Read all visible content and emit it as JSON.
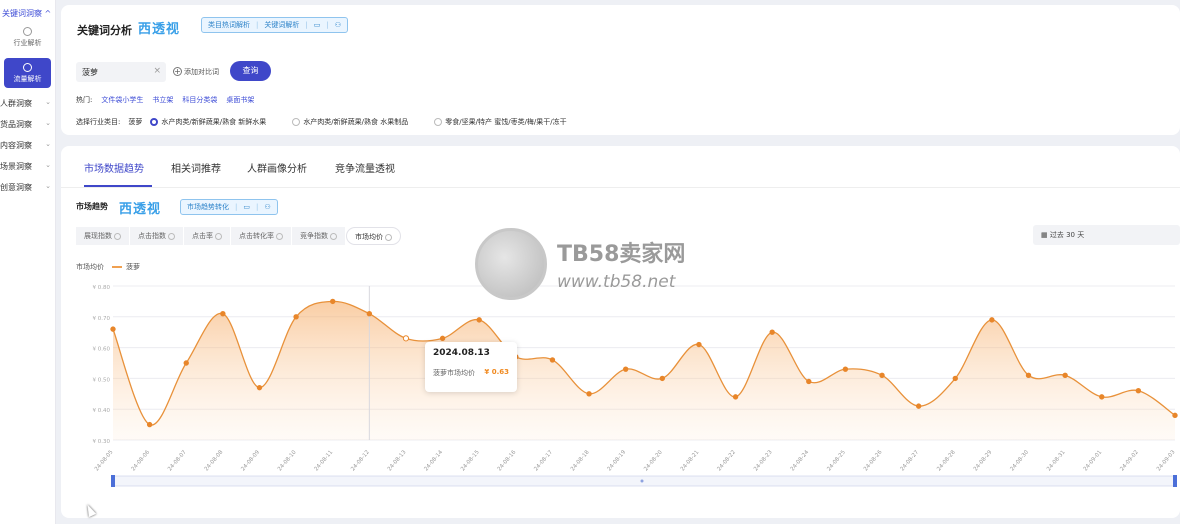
{
  "sidebar": {
    "top_label": "关键词洞察",
    "industry": "行业解析",
    "traffic": "流量解析",
    "items": [
      "人群洞察",
      "货品洞察",
      "内容洞察",
      "场景洞察",
      "创意洞察"
    ]
  },
  "header": {
    "title": "关键词分析",
    "logo": "西透视",
    "chips": [
      "类目热词解析",
      "关键词解析"
    ]
  },
  "search": {
    "value": "菠萝",
    "add_compare": "添加对比词",
    "query_button": "查询"
  },
  "hot": {
    "label": "热门:",
    "links": [
      "文件袋小学生",
      "书立架",
      "科目分类袋",
      "桌面书架"
    ]
  },
  "industry_select": {
    "label": "选择行业类目:",
    "keyword": "菠萝",
    "options": [
      "水产肉类/新鲜蔬果/熟食 新鲜水果",
      "水产肉类/新鲜蔬果/熟食 水果制品",
      "零食/坚果/特产 蜜饯/枣类/梅/果干/冻干"
    ],
    "selected": 0
  },
  "tabs": [
    "市场数据趋势",
    "相关词推荐",
    "人群画像分析",
    "竞争流量透视"
  ],
  "market": {
    "title": "市场趋势",
    "chip": "市场趋势转化",
    "metrics": [
      "展现指数",
      "点击指数",
      "点击率",
      "点击转化率",
      "竞争指数",
      "市场均价"
    ],
    "active_metric": 5,
    "date_range": "过去 30 天"
  },
  "watermark": {
    "brand": "TB58卖家网",
    "url": "www.tb58.net"
  },
  "tooltip": {
    "date": "2024.08.13",
    "label": "菠萝市场均价",
    "value": "¥ 0.63"
  },
  "colors": {
    "accent": "#3f47c9",
    "series": "#f08a20"
  },
  "chart_data": {
    "type": "area",
    "title": "市场均价",
    "ylabel": "市场均价",
    "series_name": "菠萝",
    "ylim": [
      0.3,
      0.8
    ],
    "yticks": [
      "¥ 0.30",
      "¥ 0.40",
      "¥ 0.50",
      "¥ 0.60",
      "¥ 0.70",
      "¥ 0.80"
    ],
    "x": [
      "24-08-05",
      "24-08-06",
      "24-08-07",
      "24-08-08",
      "24-08-09",
      "24-08-10",
      "24-08-11",
      "24-08-12",
      "24-08-13",
      "24-08-14",
      "24-08-15",
      "24-08-16",
      "24-08-17",
      "24-08-18",
      "24-08-19",
      "24-08-20",
      "24-08-21",
      "24-08-22",
      "24-08-23",
      "24-08-24",
      "24-08-25",
      "24-08-26",
      "24-08-27",
      "24-08-28",
      "24-08-29",
      "24-08-30",
      "24-08-31",
      "24-09-01",
      "24-09-02",
      "24-09-03"
    ],
    "values": [
      0.66,
      0.35,
      0.55,
      0.71,
      0.47,
      0.7,
      0.75,
      0.71,
      0.63,
      0.63,
      0.69,
      0.57,
      0.56,
      0.45,
      0.53,
      0.5,
      0.61,
      0.44,
      0.65,
      0.49,
      0.53,
      0.51,
      0.41,
      0.5,
      0.69,
      0.51,
      0.51,
      0.44,
      0.46,
      0.38
    ],
    "grid": true
  }
}
